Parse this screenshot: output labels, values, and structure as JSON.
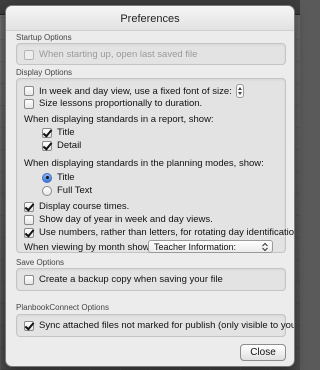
{
  "window": {
    "title": "Preferences"
  },
  "startup": {
    "section_label": "Startup Options",
    "open_last_saved": {
      "label": "When starting up, open last saved file",
      "checked": false,
      "enabled": false
    }
  },
  "display": {
    "section_label": "Display Options",
    "fixed_font": {
      "label": "In week and day view, use a fixed font of size:",
      "checked": false
    },
    "size_lessons": {
      "label": "Size lessons proportionally to duration.",
      "checked": false
    },
    "report_heading": "When displaying standards in a report, show:",
    "report_title": {
      "label": "Title",
      "checked": true
    },
    "report_detail": {
      "label": "Detail",
      "checked": true
    },
    "planning_heading": "When displaying standards in the planning modes, show:",
    "planning_title": {
      "label": "Title",
      "selected": true
    },
    "planning_full_text": {
      "label": "Full Text",
      "selected": false
    },
    "course_times": {
      "label": "Display course times.",
      "checked": true
    },
    "day_of_year": {
      "label": "Show day of year in week and day views.",
      "checked": false
    },
    "use_numbers": {
      "label": "Use numbers, rather than letters, for rotating day identification.",
      "checked": true
    },
    "month_label": "When viewing by month show:",
    "month_select": {
      "value": "Teacher Information:"
    }
  },
  "save": {
    "section_label": "Save Options",
    "backup_copy": {
      "label": "Create a backup copy when saving your file",
      "checked": false
    }
  },
  "planbook_connect": {
    "section_label": "PlanbookConnect Options",
    "sync_files": {
      "label": "Sync attached files not marked for publish (only visible to you)",
      "checked": true
    }
  },
  "close_button": {
    "label": "Close"
  }
}
